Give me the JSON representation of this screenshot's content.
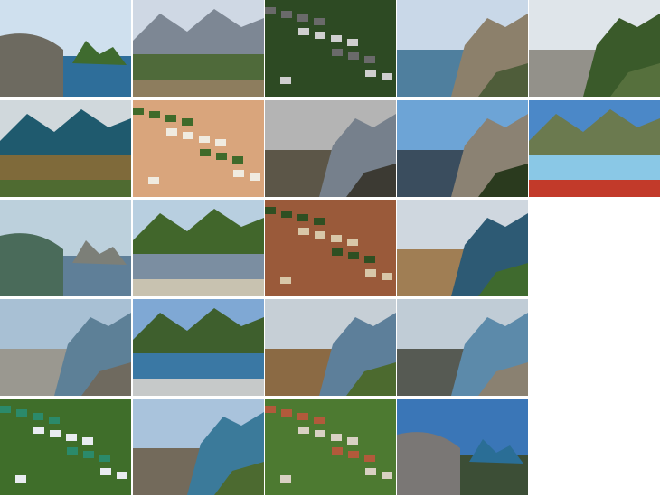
{
  "gallery": {
    "rows": 5,
    "columns": [
      5,
      5,
      4,
      4,
      4
    ],
    "thumbnails": [
      {
        "subject": "coastal-town-with-rock-photo",
        "palette": [
          "#cfe0ee",
          "#2e6e9a",
          "#3f6b2f",
          "#6d6a60"
        ]
      },
      {
        "subject": "mountain-and-town-panorama-photo",
        "palette": [
          "#cfd8e4",
          "#7d8794",
          "#4f6a3a",
          "#8d7d5e"
        ]
      },
      {
        "subject": "cypress-avenue-photo",
        "palette": [
          "#9fc1e3",
          "#2d4a23",
          "#cfcfcf",
          "#6a6a6a"
        ]
      },
      {
        "subject": "rocky-seashore-photo",
        "palette": [
          "#c9d8e8",
          "#4f7f9e",
          "#8c806b",
          "#4f5d3a"
        ]
      },
      {
        "subject": "mountain-peak-photo",
        "palette": [
          "#dfe5ea",
          "#93918a",
          "#3a5a2a",
          "#56703d"
        ]
      },
      {
        "subject": "beach-town-panorama-photo",
        "palette": [
          "#d0d8dc",
          "#1f5a6e",
          "#7f6a3a",
          "#4f6b31"
        ]
      },
      {
        "subject": "pavilion-building-photo",
        "palette": [
          "#b7d3e8",
          "#d9a57c",
          "#f0ebe0",
          "#3f6a2a"
        ]
      },
      {
        "subject": "rocky-cove-photo",
        "palette": [
          "#b4b4b4",
          "#5c5648",
          "#76808c",
          "#3c3a33"
        ]
      },
      {
        "subject": "tree-by-seaside-rocks-photo",
        "palette": [
          "#6da4d6",
          "#3a4d5e",
          "#8b8273",
          "#2a3a1e"
        ]
      },
      {
        "subject": "waterpark-slides-photo",
        "palette": [
          "#4b88c8",
          "#6b7a4f",
          "#8ac8e6",
          "#c23a2a"
        ]
      },
      {
        "subject": "lake-and-rock-photo",
        "palette": [
          "#bcd0dc",
          "#5f7f98",
          "#7c7f78",
          "#4a6b5a"
        ]
      },
      {
        "subject": "hillside-town-photo",
        "palette": [
          "#b8cfe0",
          "#41662b",
          "#7b8ea1",
          "#c8c2b0"
        ]
      },
      {
        "subject": "town-rooftops-photo",
        "palette": [
          "#4e7a34",
          "#9a5a3a",
          "#d8c7a8",
          "#2f4f22"
        ]
      },
      {
        "subject": "swan-rock-photo",
        "palette": [
          "#cfd7df",
          "#a07e54",
          "#2d5a74",
          "#3f6a2e"
        ]
      },
      {
        "subject": "cliff-with-figure-photo",
        "palette": [
          "#a8c0d4",
          "#9a9890",
          "#5d8097",
          "#6f6a5f"
        ]
      },
      {
        "subject": "bay-with-mountains-photo",
        "palette": [
          "#7fa8d4",
          "#3e5f2d",
          "#3a78a4",
          "#c6c9c9"
        ]
      },
      {
        "subject": "cat-rock-at-sea-photo",
        "palette": [
          "#c6cfd6",
          "#8b6a44",
          "#5d7f9a",
          "#4c6a2f"
        ]
      },
      {
        "subject": "seashore-with-rock-photo",
        "palette": [
          "#c0ccd6",
          "#565a53",
          "#5c8aaa",
          "#8a8171"
        ]
      },
      {
        "subject": "green-roof-villa-photo",
        "palette": [
          "#9eb8cc",
          "#3f6e2a",
          "#e9ecf1",
          "#2b8a6a"
        ]
      },
      {
        "subject": "rocky-coast-photo",
        "palette": [
          "#a9c3dc",
          "#736a5b",
          "#3b7a9a",
          "#4c6a30"
        ]
      },
      {
        "subject": "town-on-hillside-photo",
        "palette": [
          "#c9d6de",
          "#4d7a31",
          "#d9d1c3",
          "#b25a3b"
        ]
      },
      {
        "subject": "pebble-beach-photo",
        "palette": [
          "#3a76b7",
          "#3c4e36",
          "#2a6e96",
          "#7a7775"
        ]
      }
    ]
  }
}
